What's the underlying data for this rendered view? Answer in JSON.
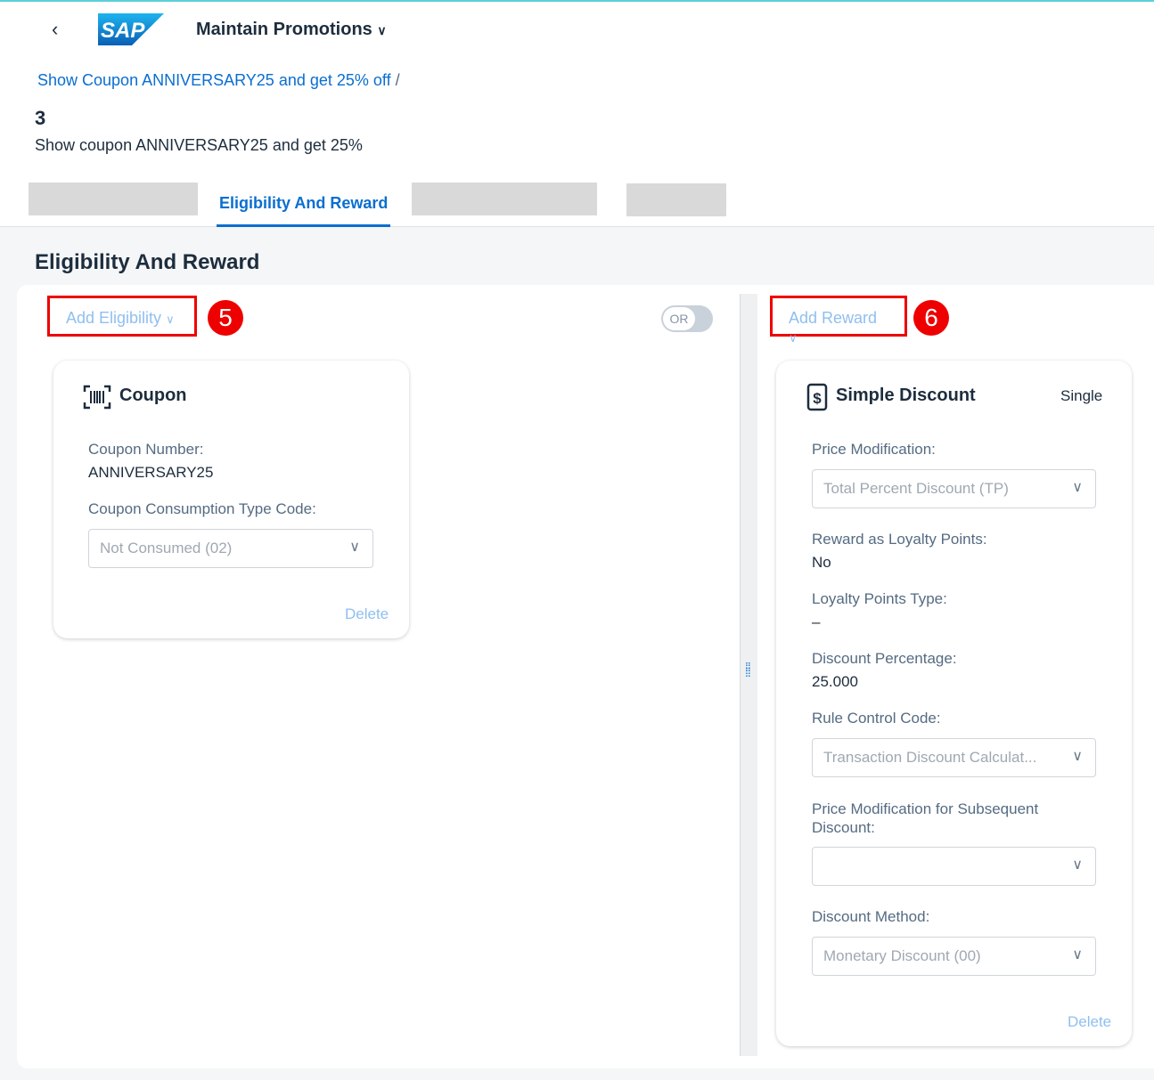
{
  "header": {
    "app_title": "Maintain Promotions",
    "logo_text": "SAP"
  },
  "breadcrumb": {
    "link": "Show Coupon ANNIVERSARY25 and get 25% off",
    "separator": "/"
  },
  "object": {
    "number": "3",
    "description": "Show coupon ANNIVERSARY25 and get 25%"
  },
  "tabs": {
    "active": "Eligibility And Reward"
  },
  "section": {
    "title": "Eligibility And Reward"
  },
  "eligibility": {
    "add_label": "Add Eligibility",
    "badge": "5",
    "toggle_label": "OR",
    "card": {
      "title": "Coupon",
      "icon": "barcode-icon",
      "coupon_number_label": "Coupon Number:",
      "coupon_number": "ANNIVERSARY25",
      "consumption_label": "Coupon Consumption Type Code:",
      "consumption_value": "Not Consumed (02)",
      "delete": "Delete"
    }
  },
  "reward": {
    "add_label": "Add Reward",
    "badge": "6",
    "card": {
      "title": "Simple Discount",
      "icon": "dollar-icon",
      "type": "Single",
      "price_mod_label": "Price Modification:",
      "price_mod_value": "Total Percent Discount (TP)",
      "loyalty_label": "Reward as Loyalty Points:",
      "loyalty_value": "No",
      "loyalty_type_label": "Loyalty Points Type:",
      "loyalty_type_value": "–",
      "discount_pct_label": "Discount Percentage:",
      "discount_pct_value": "25.000",
      "rule_label": "Rule Control Code:",
      "rule_value": "Transaction Discount Calculat...",
      "subseq_label": "Price Modification for Subsequent Discount:",
      "subseq_value": "",
      "method_label": "Discount Method:",
      "method_value": "Monetary Discount (00)",
      "delete": "Delete"
    }
  },
  "colors": {
    "accent": "#0a6ed1",
    "highlight": "#ee0000"
  }
}
